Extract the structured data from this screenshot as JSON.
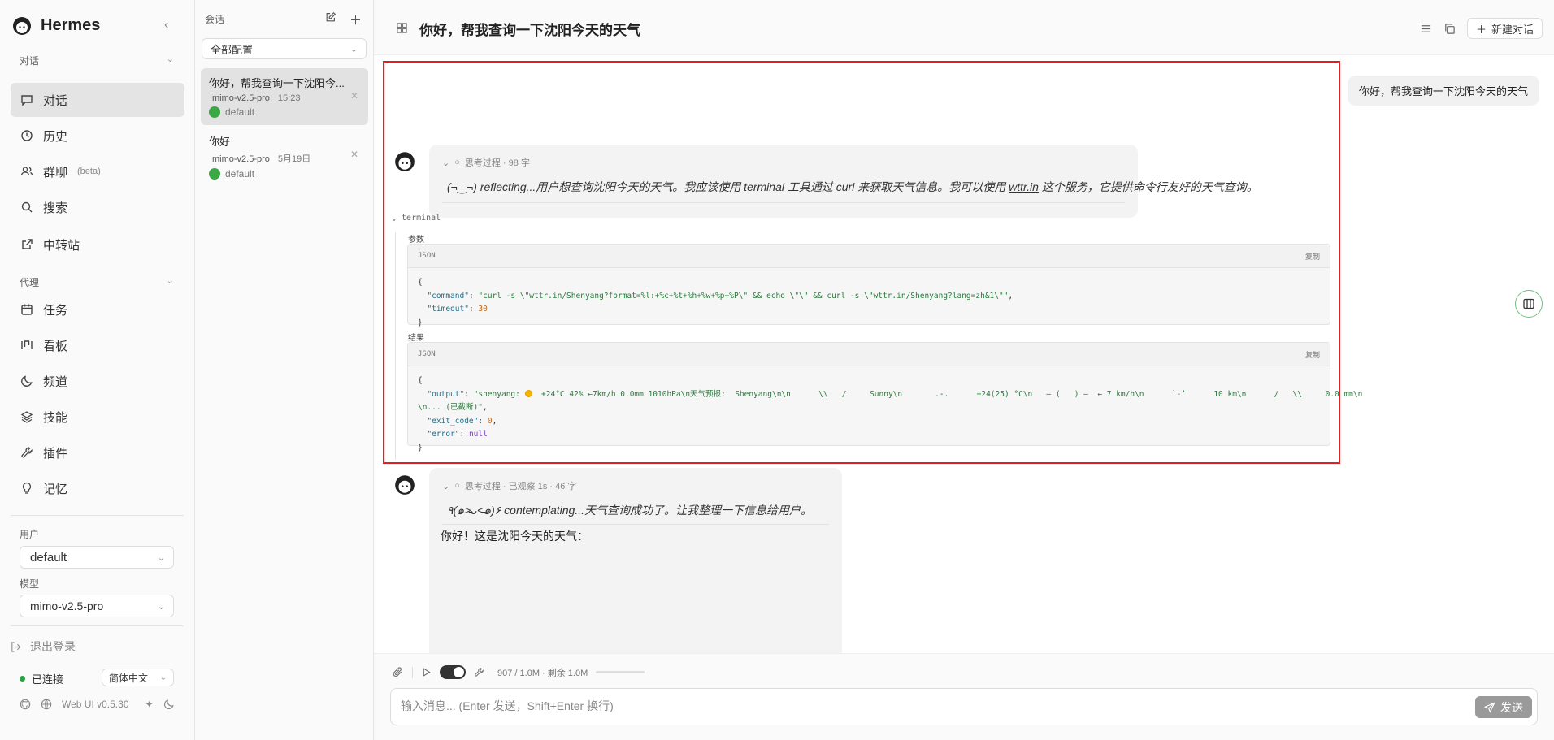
{
  "app": {
    "name": "Hermes"
  },
  "sidebar": {
    "section_chat": "对话",
    "items_chat": [
      {
        "label": "对话",
        "icon": "chat-icon"
      },
      {
        "label": "历史",
        "icon": "clock-icon"
      },
      {
        "label": "群聊",
        "badge": "(beta)",
        "icon": "users-icon"
      },
      {
        "label": "搜索",
        "icon": "search-icon"
      },
      {
        "label": "中转站",
        "icon": "external-link-icon"
      }
    ],
    "section_agent": "代理",
    "items_agent": [
      {
        "label": "任务",
        "icon": "calendar-icon"
      },
      {
        "label": "看板",
        "icon": "kanban-icon"
      },
      {
        "label": "频道",
        "icon": "moon-icon"
      },
      {
        "label": "技能",
        "icon": "layers-icon"
      },
      {
        "label": "插件",
        "icon": "wrench-icon"
      },
      {
        "label": "记忆",
        "icon": "bulb-icon"
      }
    ],
    "user_label": "用户",
    "user_value": "default",
    "model_label": "模型",
    "model_value": "mimo-v2.5-pro",
    "logout": "退出登录",
    "status": "已连接",
    "language": "简体中文",
    "version": "Web UI v0.5.30"
  },
  "conversations": {
    "title": "会话",
    "filter": "全部配置",
    "items": [
      {
        "title": "你好，帮我查询一下沈阳今...",
        "model": "mimo-v2.5-pro",
        "time": "15:23",
        "user": "default"
      },
      {
        "title": "你好",
        "model": "mimo-v2.5-pro",
        "time": "5月19日",
        "user": "default"
      }
    ]
  },
  "header": {
    "title": "你好，帮我查询一下沈阳今天的天气",
    "new_chat": "新建对话"
  },
  "chat": {
    "user_message": "你好，帮我查询一下沈阳今天的天气",
    "think1": {
      "header": "思考过程 · 98 字",
      "text_a": "(¬‿¬) reflecting...用户想查询沈阳今天的天气。我应该使用 terminal 工具通过 curl 来获取天气信息。我可以使用 ",
      "text_link": "wttr.in",
      "text_b": " 这个服务，它提供命令行友好的天气查询。"
    },
    "tool": {
      "name": "terminal",
      "params_label": "参数",
      "result_label": "结果",
      "lang": "JSON",
      "copy": "复制",
      "params": {
        "command_key": "\"command\"",
        "command_val": "\"curl -s \\\"wttr.in/Shenyang?format=%l:+%c+%t+%h+%w+%p+%P\\\" && echo \\\"\\\" && curl -s \\\"wttr.in/Shenyang?lang=zh&1\\\"\"",
        "timeout_key": "\"timeout\"",
        "timeout_val": "30"
      },
      "result": {
        "output_key": "\"output\"",
        "output_a": "\"shenyang: ",
        "output_b": "  +24°C 42% ←7km/h 0.0mm 1010hPa\\n天气预报:  Shenyang\\n\\n      \\\\   /     Sunny\\n       .-.      +24(25) °C\\n   ― (   ) ―  ← 7 km/h\\n      `-’      10 km\\n      /   \\\\     0.0 mm\\n",
        "output_c": "\\n... (已截断)\"",
        "exit_key": "\"exit_code\"",
        "exit_val": "0",
        "error_key": "\"error\"",
        "error_val": "null"
      }
    },
    "think2": {
      "header": "思考过程 · 已观察 1s · 46 字",
      "text": "٩(๑˃̵ᴗ˂̵๑)۶ contemplating...天气查询成功了。让我整理一下信息给用户。"
    },
    "answer_start": "你好！这是沈阳今天的天气："
  },
  "composer": {
    "usage": "907 / 1.0M · 剩余 1.0M",
    "usage_fraction": 0.001,
    "placeholder": "输入消息... (Enter 发送，Shift+Enter 换行)",
    "send": "发送"
  }
}
